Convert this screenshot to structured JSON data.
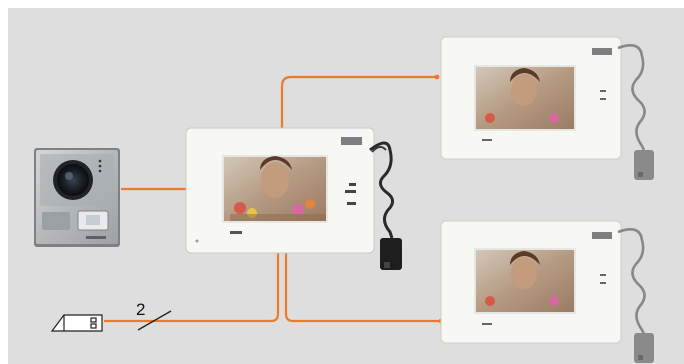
{
  "diagram": {
    "wire_count_label": "2",
    "colors": {
      "background": "#dedede",
      "wire": "#ec7a2c",
      "monitor_body": "#f7f7f4",
      "monitor_bezel": "#ecece8",
      "screen_frame": "#e6e6e2",
      "door_station": "#b9bcbf",
      "cable": "#2a2a2a"
    },
    "devices": [
      {
        "name": "door-station",
        "icon": "door-station-icon"
      },
      {
        "name": "main-monitor",
        "icon": "video-monitor-icon"
      },
      {
        "name": "extension-monitor-top",
        "icon": "video-monitor-icon"
      },
      {
        "name": "extension-monitor-bottom",
        "icon": "video-monitor-icon"
      },
      {
        "name": "door-lock-release",
        "icon": "lock-release-icon"
      },
      {
        "name": "power-adapter",
        "icon": "power-adapter-icon"
      }
    ]
  }
}
